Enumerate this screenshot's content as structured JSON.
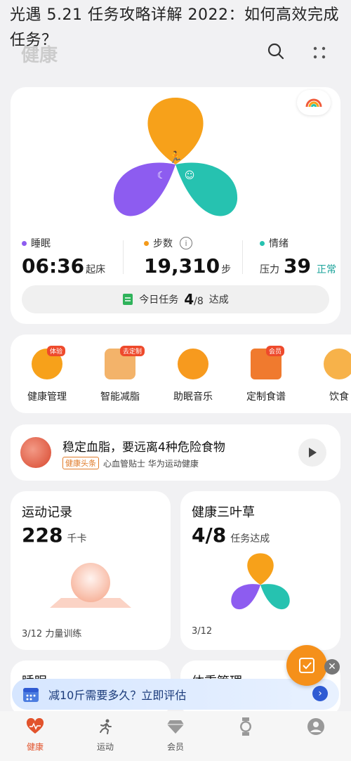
{
  "overlay": {
    "title": "光遇 5.21 任务攻略详解 2022：如何高效完成任务？"
  },
  "header": {
    "title": "健康"
  },
  "clover_colors": {
    "top": "#f7a11a",
    "left": "#8d5cf0",
    "right": "#26c2b0"
  },
  "stats": {
    "sleep": {
      "label": "睡眠",
      "value": "06:36",
      "unit": "起床",
      "color": "#8d5cf0"
    },
    "steps": {
      "label": "步数",
      "value": "19,310",
      "unit": "步",
      "color": "#f39a1a"
    },
    "mood": {
      "label": "情绪",
      "prefix": "压力",
      "value": "39",
      "status": "正常",
      "color": "#26c2b0"
    }
  },
  "task": {
    "label": "今日任务",
    "done": "4",
    "total": "/8",
    "suffix": "达成"
  },
  "services": [
    {
      "name": "健康管理",
      "badge": "体验",
      "icon": "health-management-icon"
    },
    {
      "name": "智能减脂",
      "badge": "去定制",
      "icon": "fat-loss-icon"
    },
    {
      "name": "助眠音乐",
      "badge": "",
      "icon": "sleep-music-icon"
    },
    {
      "name": "定制食谱",
      "badge": "会员",
      "icon": "recipe-icon"
    },
    {
      "name": "饮食",
      "badge": "",
      "icon": "diet-icon"
    }
  ],
  "article": {
    "title": "稳定血脂，要远离4种危险食物",
    "tag": "健康头条",
    "source": "心血管贴士 华为运动健康"
  },
  "exercise": {
    "title": "运动记录",
    "value": "228",
    "unit": "千卡",
    "footer": "3/12 力量训练"
  },
  "clover_card": {
    "title": "健康三叶草",
    "value": "4/8",
    "unit": "任务达成",
    "footer": "3/12"
  },
  "partial": {
    "left": "睡眠",
    "right": "体重管理"
  },
  "promo": {
    "text": "减10斤需要多久？立即评估"
  },
  "tabs": [
    {
      "label": "健康",
      "icon": "heart-icon"
    },
    {
      "label": "运动",
      "icon": "runner-icon"
    },
    {
      "label": "会员",
      "icon": "diamond-icon"
    },
    {
      "label": "",
      "icon": "watch-icon"
    },
    {
      "label": "",
      "icon": "profile-icon"
    }
  ]
}
